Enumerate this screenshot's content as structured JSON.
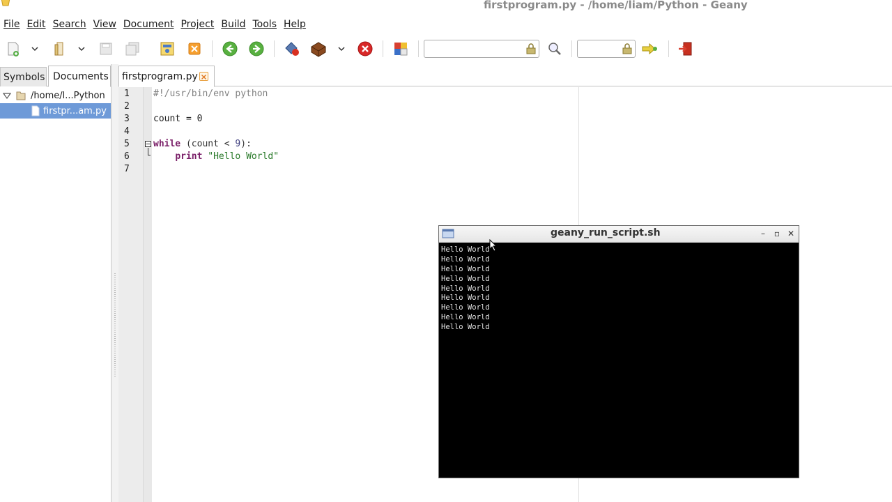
{
  "window": {
    "title": "firstprogram.py - /home/liam/Python - Geany"
  },
  "menubar": {
    "items": [
      "File",
      "Edit",
      "Search",
      "View",
      "Document",
      "Project",
      "Build",
      "Tools",
      "Help"
    ]
  },
  "toolbar": {
    "search_value": "",
    "goto_value": "",
    "icons": [
      "new-file-icon",
      "open-file-icon",
      "save-icon",
      "save-all-icon",
      "reload-icon",
      "close-icon",
      "back-icon",
      "forward-icon",
      "compile-icon",
      "build-icon",
      "stop-icon",
      "color-chooser-icon",
      "search-icon",
      "goto-line-icon",
      "quit-icon"
    ]
  },
  "sidebar": {
    "tabs": [
      "Symbols",
      "Documents"
    ],
    "active_tab": "Documents",
    "tree": {
      "folder": "/home/l...Python",
      "file": "firstpr...am.py"
    }
  },
  "editor": {
    "tab_label": "firstprogram.py",
    "line_numbers": [
      "1",
      "2",
      "3",
      "4",
      "5",
      "6",
      "7"
    ],
    "lines": [
      {
        "comment": "#!/usr/bin/env python"
      },
      {},
      {
        "plain": "count = 0"
      },
      {},
      {
        "kw": "while",
        "rest": " (count < ",
        "num": "9",
        "end": "):"
      },
      {
        "indent": "    ",
        "kw": "print",
        "space": " ",
        "str": "\"Hello World\""
      },
      {}
    ]
  },
  "terminal": {
    "title": "geany_run_script.sh",
    "output": [
      "Hello World",
      "Hello World",
      "Hello World",
      "Hello World",
      "Hello World",
      "Hello World",
      "Hello World",
      "Hello World",
      "Hello World"
    ]
  },
  "colors": {
    "selection": "#6e9ad8",
    "keyword": "#7a1f68",
    "string": "#2a7a2a",
    "comment": "#808080",
    "terminal_bg": "#000000"
  }
}
